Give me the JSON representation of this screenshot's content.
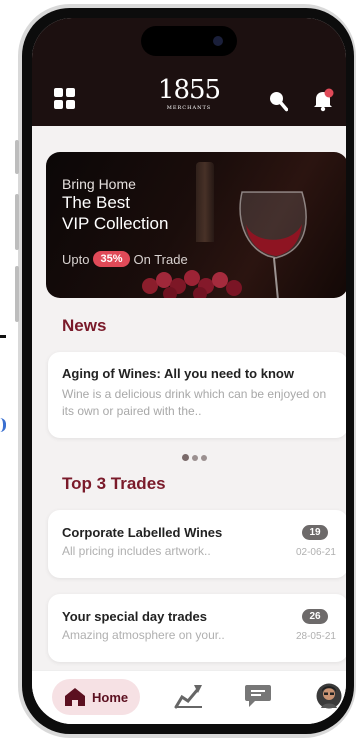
{
  "header": {
    "logo_number": "1855",
    "logo_subtitle": "MERCHANTS",
    "icons": [
      "grid-icon",
      "search-icon",
      "bell-icon"
    ]
  },
  "banner": {
    "line1": "Bring Home",
    "line2": "The Best",
    "line3": "VIP Collection",
    "promo_prefix": "Upto",
    "promo_badge": "35%",
    "promo_suffix": "On Trade"
  },
  "news": {
    "section_title": "News",
    "item": {
      "title": "Aging of Wines: All you need to know",
      "body": "Wine is a delicious drink which can be enjoyed on its own or paired with the.."
    }
  },
  "trades": {
    "section_title": "Top 3 Trades",
    "items": [
      {
        "title": "Corporate Labelled Wines",
        "subtitle": "All pricing includes artwork..",
        "count": "19",
        "date": "02-06-21"
      },
      {
        "title": "Your special day trades",
        "subtitle": "Amazing atmosphere on your..",
        "count": "26",
        "date": "28-05-21"
      }
    ]
  },
  "bottom_nav": {
    "home_label": "Home",
    "items": [
      "home-icon",
      "trade-icon",
      "chat-icon",
      "avatar"
    ]
  },
  "colors": {
    "brand": "#7a1a2a",
    "header_bg": "#1c1010",
    "badge": "#e04a58",
    "home_pill": "#f6e1e4"
  }
}
